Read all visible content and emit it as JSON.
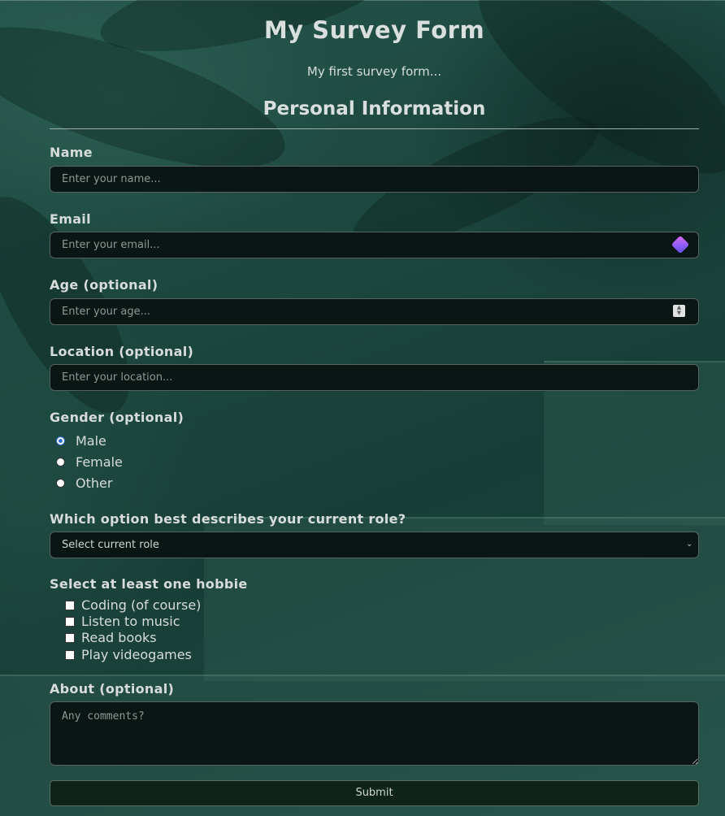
{
  "header": {
    "title": "My Survey Form",
    "subtitle": "My first survey form...",
    "section_title": "Personal Information"
  },
  "fields": {
    "name": {
      "label": "Name",
      "placeholder": "Enter your name..."
    },
    "email": {
      "label": "Email",
      "placeholder": "Enter your email..."
    },
    "age": {
      "label": "Age (optional)",
      "placeholder": "Enter your age..."
    },
    "location": {
      "label": "Location (optional)",
      "placeholder": "Enter your location..."
    }
  },
  "gender": {
    "label": "Gender (optional)",
    "options": [
      "Male",
      "Female",
      "Other"
    ],
    "selected": "Male"
  },
  "role": {
    "label": "Which option best describes your current role?",
    "selected": "Select current role"
  },
  "hobbies": {
    "label": "Select at least one hobbie",
    "options": [
      "Coding (of course)",
      "Listen to music",
      "Read books",
      "Play videogames"
    ]
  },
  "about": {
    "label": "About (optional)",
    "placeholder": "Any comments?"
  },
  "submit": {
    "label": "Submit"
  },
  "colors": {
    "background": "#1c463e",
    "field_bg": "#0a1614",
    "submit_bg": "#0e2418",
    "radio_selected": "#2f6fd6"
  }
}
